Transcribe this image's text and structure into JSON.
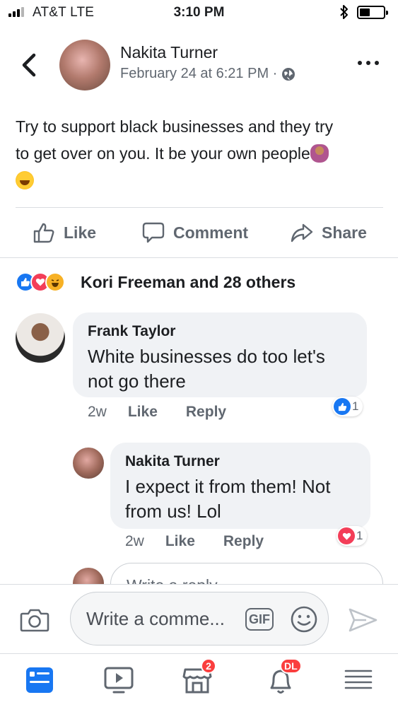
{
  "status_bar": {
    "carrier": "AT&T  LTE",
    "time": "3:10 PM",
    "icons": [
      "signal-icon",
      "bluetooth-icon",
      "battery-icon"
    ]
  },
  "post": {
    "author": "Nakita Turner",
    "date": "February 24 at 6:21 PM ·",
    "privacy_icon": "globe-icon",
    "text_line1": "Try to support black businesses and they try",
    "text_line2": "to get over on you. It be your own people",
    "emojis": [
      "person-shrugging-emoji",
      "tears-of-joy-emoji"
    ]
  },
  "actions": {
    "like": "Like",
    "comment": "Comment",
    "share": "Share"
  },
  "reactions": {
    "icons": [
      "like-reaction-icon",
      "love-reaction-icon",
      "haha-reaction-icon"
    ],
    "summary": "Kori Freeman and 28 others"
  },
  "comments": [
    {
      "author": "Frank Taylor",
      "text_line1": "White businesses do too let's",
      "text_line2": "not go there",
      "age": "2w",
      "like_label": "Like",
      "reply_label": "Reply",
      "reaction_type": "like",
      "reaction_count": "1"
    },
    {
      "author": "Nakita Turner",
      "text_line1": "I expect it from them! Not",
      "text_line2": "from us! Lol",
      "age": "2w",
      "like_label": "Like",
      "reply_label": "Reply",
      "reaction_type": "love",
      "reaction_count": "1"
    }
  ],
  "reply_box": {
    "placeholder": "Write a reply..."
  },
  "composer": {
    "placeholder": "Write a comme...",
    "gif_label": "GIF"
  },
  "tab_bar": {
    "tabs": [
      "news-feed-icon",
      "watch-icon",
      "marketplace-icon",
      "notifications-icon",
      "menu-icon"
    ],
    "marketplace_badge": "2",
    "notifications_badge": "DL"
  },
  "colors": {
    "brand_blue": "#1877f2",
    "love_red": "#f33e58",
    "haha_yellow": "#f7b125",
    "badge_red": "#fa3e3e"
  }
}
